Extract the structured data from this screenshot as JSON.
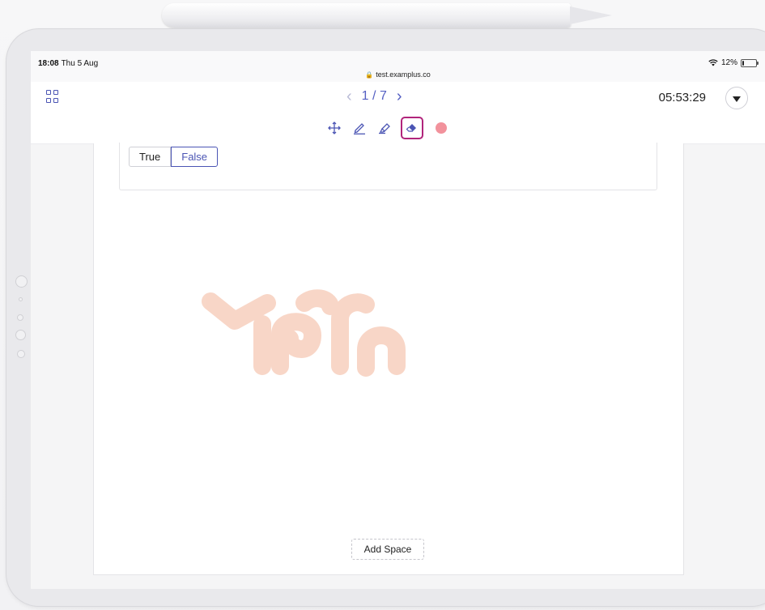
{
  "status_bar": {
    "time": "18:08",
    "date": "Thu 5 Aug",
    "url": "test.examplus.co",
    "battery": "12%",
    "battery_level": 0.12
  },
  "header": {
    "page_current": "1",
    "page_total": "7",
    "page_separator": "/",
    "timer": "05:53:29",
    "prev_icon": "chevron-left-icon",
    "next_icon": "chevron-right-icon",
    "grid_icon": "grid-icon",
    "dropdown_icon": "caret-down-icon"
  },
  "toolbar": {
    "tools": [
      "move-icon",
      "pen-icon",
      "highlighter-icon",
      "eraser-icon"
    ],
    "selected_tool": "eraser",
    "selected_border_color": "#b1247b",
    "ink_color": "#f2929c"
  },
  "question": {
    "options": [
      "True",
      "False"
    ],
    "selected": "False"
  },
  "actions": {
    "add_space": "Add Space"
  },
  "colors": {
    "accent": "#4b55b4",
    "watermark": "#f6c9b5"
  }
}
